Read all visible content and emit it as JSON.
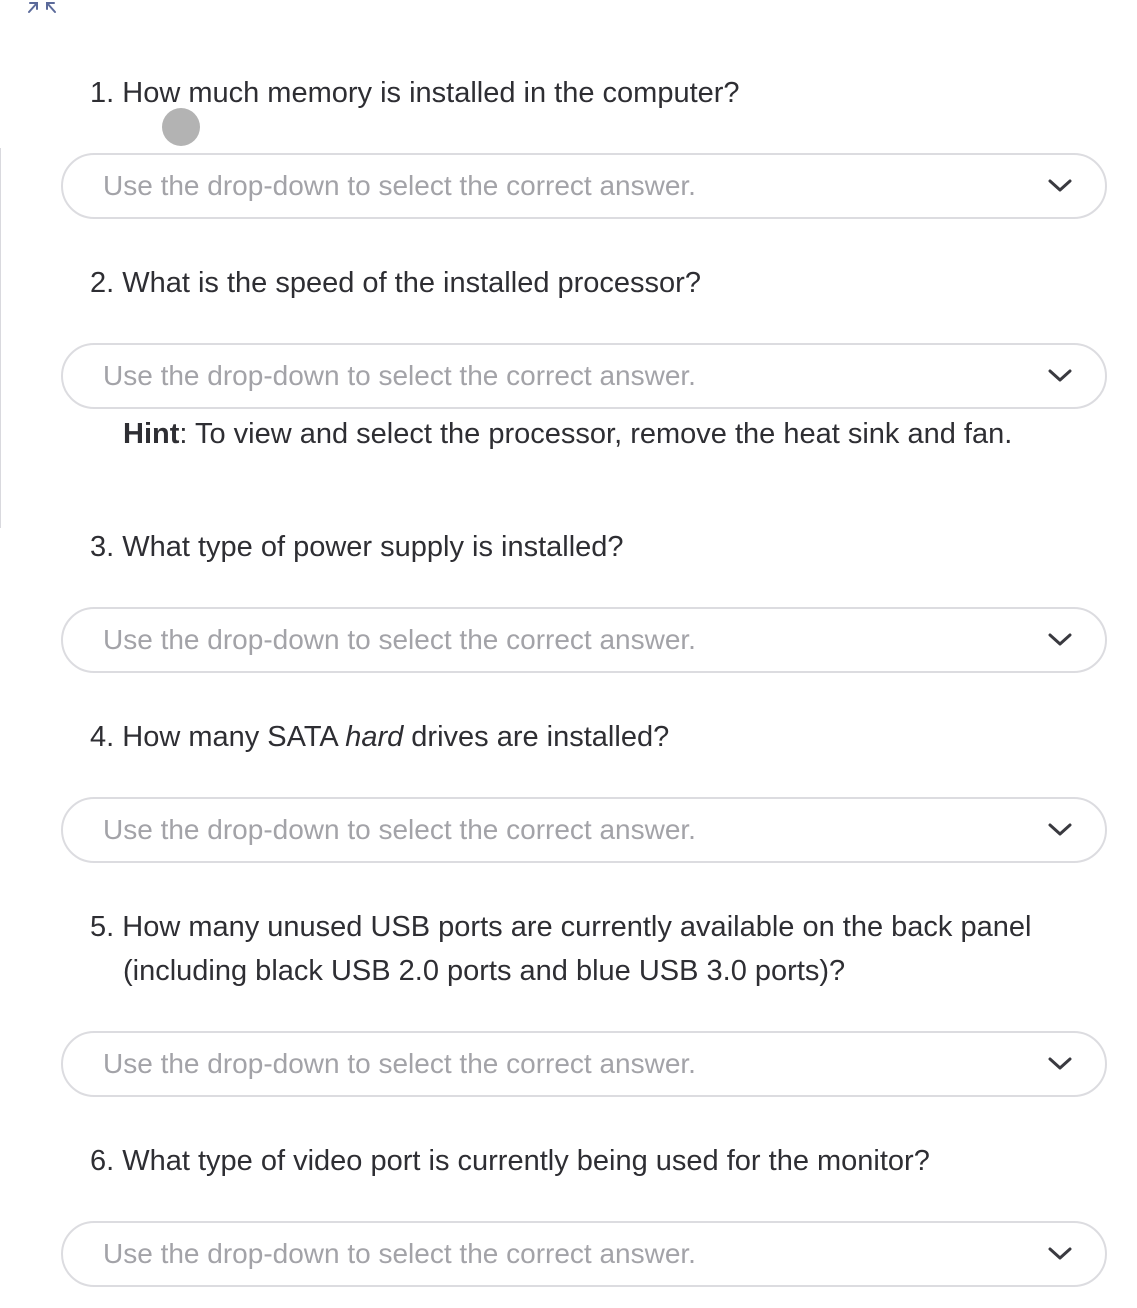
{
  "header": {
    "collapse_icon": "collapse-arrows-icon"
  },
  "placeholder": "Use the drop-down to select the correct answer.",
  "questions": [
    {
      "number": "1.",
      "text": "How much memory is installed in the computer?"
    },
    {
      "number": "2.",
      "text": "What is the speed of the installed processor?"
    },
    {
      "number": "3.",
      "text": "What type of power supply is installed?"
    },
    {
      "number": "4.",
      "text_before": "How many SATA ",
      "text_emphasis": "hard",
      "text_after": " drives are installed?"
    },
    {
      "number": "5.",
      "text": "How many unused USB ports are currently available on the back panel (including black USB 2.0 ports and blue USB 3.0 ports)?"
    },
    {
      "number": "6.",
      "text": "What type of video port is currently being used for the monitor?"
    }
  ],
  "hint": {
    "label": "Hint",
    "text": ": To view and select the processor, remove the heat sink and fan."
  },
  "dropdowns": [
    {
      "value": "Use the drop-down to select the correct answer."
    },
    {
      "value": "Use the drop-down to select the correct answer."
    },
    {
      "value": "Use the drop-down to select the correct answer."
    },
    {
      "value": "Use the drop-down to select the correct answer."
    },
    {
      "value": "Use the drop-down to select the correct answer."
    },
    {
      "value": "Use the drop-down to select the correct answer."
    }
  ],
  "colors": {
    "text": "#2e2e33",
    "placeholder": "#a3a3a8",
    "border": "#dcdce0",
    "chevron": "#3a3a40",
    "icon": "#5b6a9a"
  }
}
